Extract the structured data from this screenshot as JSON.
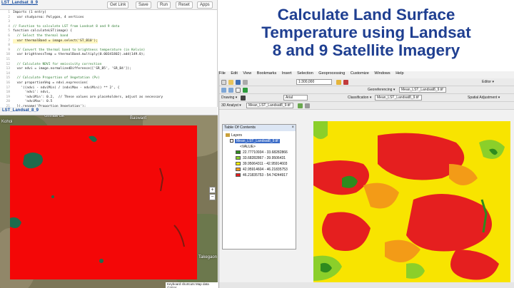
{
  "gee": {
    "tab_label": "LST_Landsat_8_9",
    "buttons": [
      "Get Link",
      "Save",
      "Run",
      "Reset",
      "Apps"
    ],
    "lines": [
      {
        "n": "1",
        "html": "Imports (1 entry)"
      },
      {
        "n": "2",
        "html": "  var studyarea: Polygon, 4 vertices"
      },
      {
        "n": "3",
        "html": ""
      },
      {
        "n": "4",
        "html": "// Function to calculate LST from Landsat 8 and 9 data"
      },
      {
        "n": "5",
        "html": "function calculateLST(image) {"
      },
      {
        "n": "6",
        "html": "  // Select the thermal band"
      },
      {
        "n": "7",
        "html": "  var thermalBand = image.select('ST_B10');"
      },
      {
        "n": "8",
        "html": ""
      },
      {
        "n": "9",
        "html": "  // Convert the thermal band to brightness temperature (in Kelvin)"
      },
      {
        "n": "10",
        "html": "  var brightnessTemp = thermalBand.multiply(0.00341802).add(149.0);"
      },
      {
        "n": "11",
        "html": ""
      },
      {
        "n": "12",
        "html": "  // Calculate NDVI for emissivity correction"
      },
      {
        "n": "13",
        "html": "  var ndvi = image.normalizedDifference(['SR_B5', 'SR_B4']);"
      },
      {
        "n": "14",
        "html": ""
      },
      {
        "n": "15",
        "html": "  // Calculate Proportion of Vegetation (Pv)"
      },
      {
        "n": "16",
        "html": "  var proportionVeg = ndvi.expression("
      },
      {
        "n": "17",
        "html": "    '((ndvi - ndviMin) / (ndviMax - ndviMin)) ** 2', {"
      },
      {
        "n": "18",
        "html": "      'ndvi': ndvi,"
      },
      {
        "n": "19",
        "html": "      'ndviMin': 0.2,  // These values are placeholders, adjust as necessary"
      },
      {
        "n": "20",
        "html": "      'ndviMax': 0.5"
      },
      {
        "n": "21",
        "html": "  }).rename('Proportion_Vegetation');"
      }
    ]
  },
  "title": {
    "line1": "Calculate Land Surface",
    "line2": "Temperature using Landsat",
    "line3": "8 and 9 Satellite Imagery"
  },
  "map_left": {
    "layer_tab": "LST_Landsat_8_9",
    "places": [
      "Kohoi",
      "Umrale Bk",
      "Pimpalgaon Baswant",
      "Takegaon"
    ],
    "footer": "Keyboard shortcuts  Map data ©2024"
  },
  "arc": {
    "menu": [
      "File",
      "Edit",
      "View",
      "Bookmarks",
      "Insert",
      "Selection",
      "Geoprocessing",
      "Customize",
      "Windows",
      "Help"
    ],
    "scale": "1:300,000",
    "georef_label": "Georeferencing ▾",
    "georef_layer": "Mean_LST_Landsat8_9.tif",
    "editor_label": "Editor ▾",
    "drawing_label": "Drawing ▾",
    "font_name": "Arial",
    "classification_label": "Classification ▾",
    "classification_layer": "Mean_LST_Landsat8_9.tif",
    "spatial_adjust": "Spatial Adjustment ▾",
    "analyst_label": "3D Analyst ▾",
    "analyst_layer": "Mean_LST_Landsat8_9.tif",
    "toc_title": "Table Of Contents",
    "toc_layers": "Layers",
    "toc_layer_name": "Mean_LST_Landsat8_9.tif",
    "toc_value": "<VALUE>",
    "legend": [
      {
        "label": "22.77710934 - 33.68282866",
        "color": "#2e8b1e"
      },
      {
        "label": "33.68282867 - 39.9506431",
        "color": "#8bcf2a"
      },
      {
        "label": "39.95064311 - 42.95914603",
        "color": "#f2ef00"
      },
      {
        "label": "42.95914604 - 46.21835753",
        "color": "#f39b17"
      },
      {
        "label": "46.21835753 - 54.74244917",
        "color": "#e51f1f"
      }
    ]
  },
  "colors": {
    "title": "#1f3f91",
    "raster_red": "#f40707"
  }
}
